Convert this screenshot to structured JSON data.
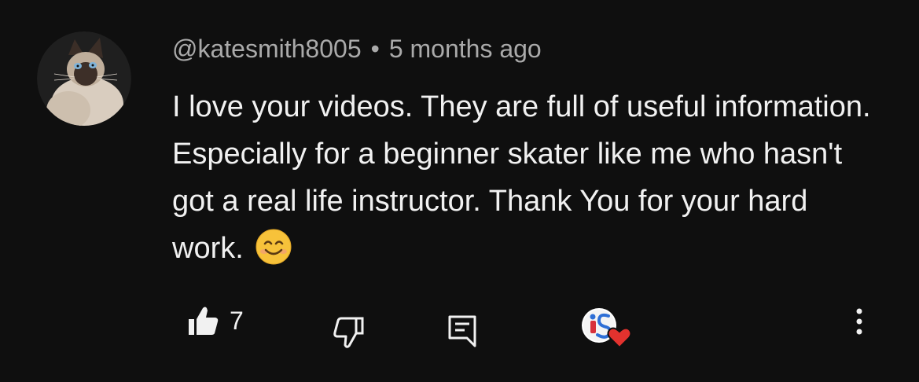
{
  "comment": {
    "author": "@katesmith8005",
    "separator": "•",
    "time": "5 months ago",
    "text": "I love your videos. They are full of useful information. Especially for a beginner skater like me who hasn't got a real life instructor. Thank You for your hard work.",
    "emoji": "smiling-face-emoji",
    "avatar": "siamese-cat-avatar"
  },
  "actions": {
    "like_count": "7",
    "like_icon": "thumbs-up-icon",
    "dislike_icon": "thumbs-down-icon",
    "reply_icon": "reply-icon",
    "hearted_icon": "creator-heart-badge",
    "more_icon": "more-vert-icon"
  },
  "colors": {
    "background": "#0f0f0f",
    "text": "#f1f1f1",
    "meta": "#aaaaaa",
    "heart": "#e3322e",
    "emoji": "#f7c23a"
  }
}
